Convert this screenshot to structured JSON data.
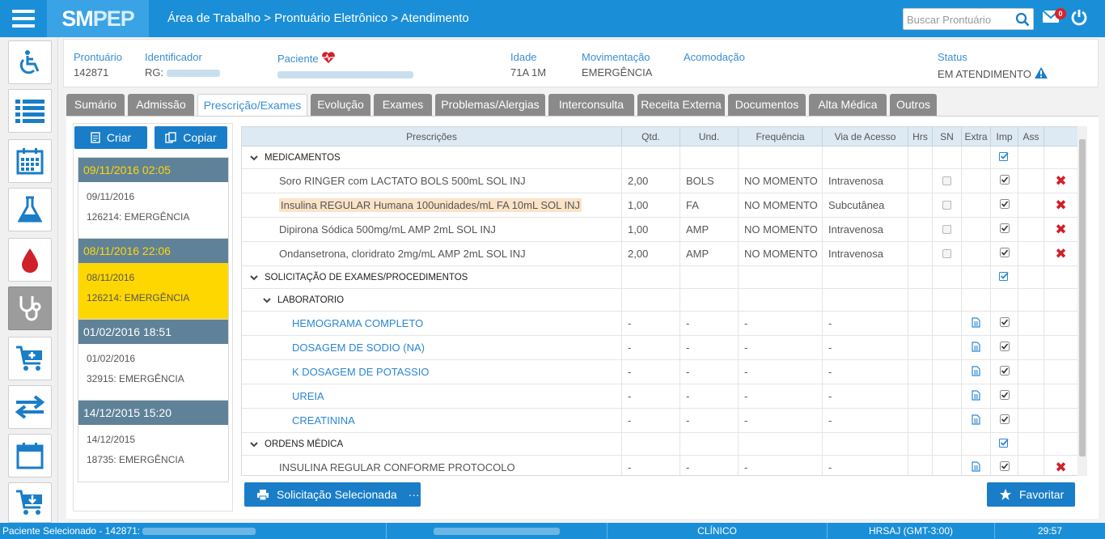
{
  "app": {
    "logo_bold": "SM",
    "logo_light": "PEP",
    "breadcrumb": "Área de Trabalho > Prontuário Eletrônico > Atendimento",
    "search_placeholder": "Buscar Prontuário",
    "mail_count": "0"
  },
  "patient": {
    "prontuario_label": "Prontuário",
    "prontuario_value": "142871",
    "identificador_label": "Identificador",
    "identificador_value": "RG:",
    "paciente_label": "Paciente",
    "idade_label": "Idade",
    "idade_value": "71A 1M",
    "movimentacao_label": "Movimentação",
    "movimentacao_value": "EMERGÊNCIA",
    "acomodacao_label": "Acomodação",
    "status_label": "Status",
    "status_value": "EM ATENDIMENTO"
  },
  "tabs": [
    "Sumário",
    "Admissão",
    "Prescrição/Exames",
    "Evolução",
    "Exames",
    "Problemas/Alergias",
    "Interconsulta",
    "Receita Externa",
    "Documentos",
    "Alta Médica",
    "Outros"
  ],
  "actions": {
    "criar": "Criar",
    "copiar": "Copiar",
    "solicitacao": "Solicitação Selecionada",
    "favoritar": "Favoritar"
  },
  "cards": [
    {
      "header": "09/11/2016 02:05",
      "date": "09/11/2016",
      "info": "126214: EMERGÊNCIA"
    },
    {
      "header": "08/11/2016 22:06",
      "date": "08/11/2016",
      "info": "126214: EMERGÊNCIA"
    },
    {
      "header": "01/02/2016 18:51",
      "date": "01/02/2016",
      "info": "32915: EMERGÊNCIA"
    },
    {
      "header": "14/12/2015 15:20",
      "date": "14/12/2015",
      "info": "18735: EMERGÊNCIA"
    }
  ],
  "grid": {
    "headers": [
      "Prescrições",
      "Qtd.",
      "Und.",
      "Frequência",
      "Via de Acesso",
      "Hrs",
      "SN",
      "Extra",
      "Imp",
      "Ass"
    ],
    "groups": {
      "medicamentos": "MEDICAMENTOS",
      "exames": "SOLICITAÇÃO DE EXAMES/PROCEDIMENTOS",
      "laboratorio": "LABORATORIO",
      "ordens": "ORDENS MÉDICA"
    },
    "meds": [
      {
        "name": "Soro RINGER com LACTATO BOLS 500mL SOL INJ",
        "qtd": "2,00",
        "und": "BOLS",
        "freq": "NO MOMENTO",
        "via": "Intravenosa"
      },
      {
        "name": "Insulina REGULAR Humana 100unidades/mL FA 10mL SOL INJ",
        "qtd": "1,00",
        "und": "FA",
        "freq": "NO MOMENTO",
        "via": "Subcutânea"
      },
      {
        "name": "Dipirona Sódica 500mg/mL AMP 2mL SOL INJ",
        "qtd": "1,00",
        "und": "AMP",
        "freq": "NO MOMENTO",
        "via": "Intravenosa"
      },
      {
        "name": "Ondansetrona, cloridrato 2mg/mL AMP 2mL SOL INJ",
        "qtd": "2,00",
        "und": "AMP",
        "freq": "NO MOMENTO",
        "via": "Intravenosa"
      }
    ],
    "labs": [
      "HEMOGRAMA COMPLETO",
      "DOSAGEM DE SODIO (NA)",
      "K DOSAGEM DE POTASSIO",
      "UREIA",
      "CREATININA"
    ],
    "ordens": [
      "INSULINA REGULAR CONFORME PROTOCOLO"
    ],
    "dash": "-"
  },
  "statusbar": {
    "paciente": "Paciente Selecionado - 142871:",
    "clinico": "CLÍNICO",
    "hrsaj": "HRSAJ (GMT-3:00)",
    "time": "29:57"
  },
  "colors": {
    "primary": "#1a8fd8",
    "card_header": "#5f8299",
    "selected_card": "#ffd700",
    "delete": "#d0202a",
    "highlight": "#fbe3c8"
  }
}
